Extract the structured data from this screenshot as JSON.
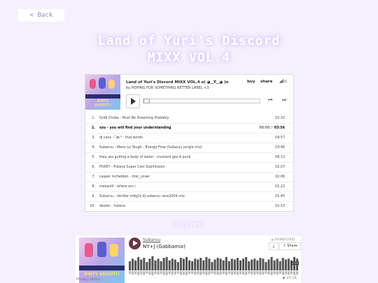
{
  "nav": {
    "back_label": "< Back"
  },
  "page": {
    "title_line1": "Land of Yuri's Discord",
    "title_line2": "MIXX VOL.4"
  },
  "player": {
    "album_title": "Land of Yuri's Discord MIXX VOL.4 o( ◕‿∇‿◕ )o",
    "artist_line": "by HOPING FOR SOMETHING BETTER LABEL <3",
    "buy_label": "buy",
    "share_label": "share",
    "bc_logo": "◢bc",
    "art_label": "DIRTY SHOUT!!",
    "tracks": [
      {
        "num": "1.",
        "name": "Gridi Chilee - Must Be Dreaming Probably",
        "time": "02:32",
        "elapsed": ""
      },
      {
        "num": "2.",
        "name": "szu - you will find your understanding",
        "time": "03:56",
        "elapsed": "00:00 /"
      },
      {
        "num": "3.",
        "name": "dj casa ⋆˚✿˖° - thal words",
        "time": "04:57",
        "elapsed": ""
      },
      {
        "num": "4.",
        "name": "Subaruu - Mano Lo Tough - Energy Flow (Subaruu jungle mix)",
        "time": "03:46",
        "elapsed": ""
      },
      {
        "num": "5.",
        "name": "they are guiting a body of water - mustard gas A punk",
        "time": "06:13",
        "elapsed": ""
      },
      {
        "num": "6.",
        "name": "PUKEY - Pukeys Super Cool Submission",
        "time": "02:07",
        "elapsed": ""
      },
      {
        "num": "7.",
        "name": "casper mcfadden - titor_cover",
        "time": "02:06",
        "elapsed": ""
      },
      {
        "num": "8.",
        "name": "makais9 - where am i",
        "time": "01:22",
        "elapsed": ""
      },
      {
        "num": "9.",
        "name": "Subaruu - dön9ar m4g1k dj subaruu rave2004 mix",
        "time": "01:45",
        "elapsed": ""
      },
      {
        "num": "10.",
        "name": "dexter - hatena",
        "time": "02:53",
        "elapsed": ""
      }
    ],
    "current_index": 2
  },
  "singles": {
    "heading": "Singles:",
    "user": "Subaruu",
    "track": "NY+J (Gabbamix)",
    "sc_logo": "☁ SOUNDCLOUD",
    "download_icon_glyph": "⤓",
    "share_label": "⇪ Share",
    "time": "3:50",
    "plays": "▶ 20.1K",
    "privacy": "Privacy policy",
    "waveform": [
      0.55,
      0.7,
      0.6,
      0.8,
      0.65,
      0.75,
      0.5,
      0.7,
      0.85,
      0.6,
      0.7,
      0.55,
      0.75,
      0.8,
      0.6,
      0.7,
      0.65,
      0.5,
      0.75,
      0.7,
      0.8,
      0.6,
      0.55,
      0.7,
      0.65,
      0.75,
      0.6,
      0.8,
      0.7,
      0.5,
      0.65,
      0.75,
      0.7,
      0.6,
      0.8,
      0.55,
      0.7,
      0.65,
      0.75,
      0.6,
      0.7,
      0.8,
      0.55,
      0.65,
      0.7,
      0.6,
      0.75,
      0.7,
      0.5,
      0.65,
      0.8,
      0.6,
      0.7,
      0.55,
      0.75,
      0.65,
      0.7,
      0.6,
      0.8,
      0.7
    ]
  }
}
